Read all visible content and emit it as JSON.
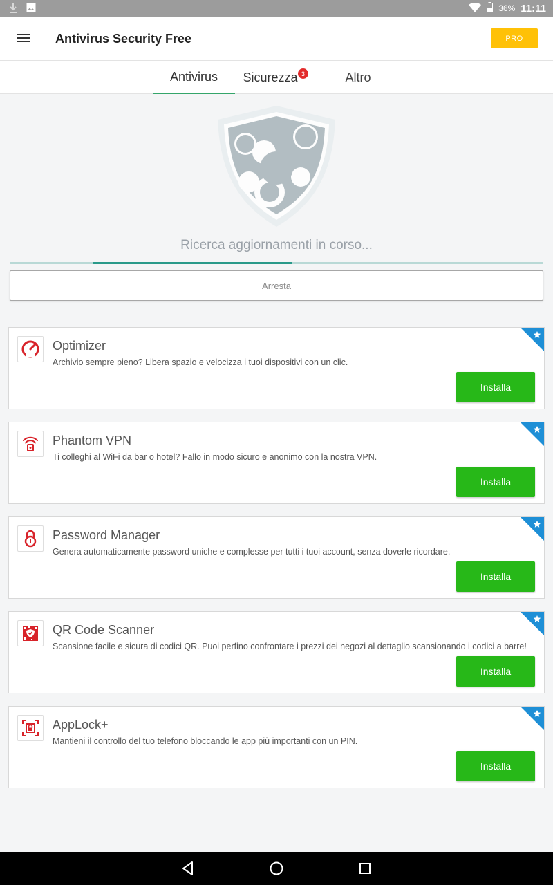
{
  "status_bar": {
    "battery": "36%",
    "time": "11:11"
  },
  "app_bar": {
    "title": "Antivirus Security Free",
    "pro_label": "PRO"
  },
  "tabs": [
    {
      "label": "Antivirus",
      "active": true
    },
    {
      "label": "Sicurezza",
      "badge": "3"
    },
    {
      "label": "Altro"
    }
  ],
  "scan": {
    "status": "Ricerca aggiornamenti in corso...",
    "stop_label": "Arresta"
  },
  "cards": [
    {
      "name": "Optimizer",
      "description": "Archivio sempre pieno? Libera spazio e velocizza i tuoi dispositivi con un clic.",
      "install_label": "Installa",
      "icon": "speedometer-icon"
    },
    {
      "name": "Phantom VPN",
      "description": "Ti colleghi al WiFi da bar o hotel? Fallo in modo sicuro e anonimo con la nostra VPN.",
      "install_label": "Installa",
      "icon": "wifi-lock-icon"
    },
    {
      "name": "Password Manager",
      "description": "Genera automaticamente password uniche e complesse per tutti i tuoi account, senza doverle ricordare.",
      "install_label": "Installa",
      "icon": "padlock-icon"
    },
    {
      "name": "QR Code Scanner",
      "description": "Scansione facile e sicura di codici QR. Puoi perfino confrontare i prezzi dei negozi al dettaglio scansionando i codici a barre!",
      "install_label": "Installa",
      "icon": "qr-shield-icon"
    },
    {
      "name": "AppLock+",
      "description": "Mantieni il controllo del tuo telefono bloccando le app più importanti con un PIN.",
      "install_label": "Installa",
      "icon": "applock-icon"
    }
  ],
  "colors": {
    "accent": "#35a56a",
    "install": "#27b818",
    "pro": "#ffc107",
    "badge": "#e32b2b",
    "corner": "#1e8fd6",
    "icon_red": "#d8232a"
  }
}
